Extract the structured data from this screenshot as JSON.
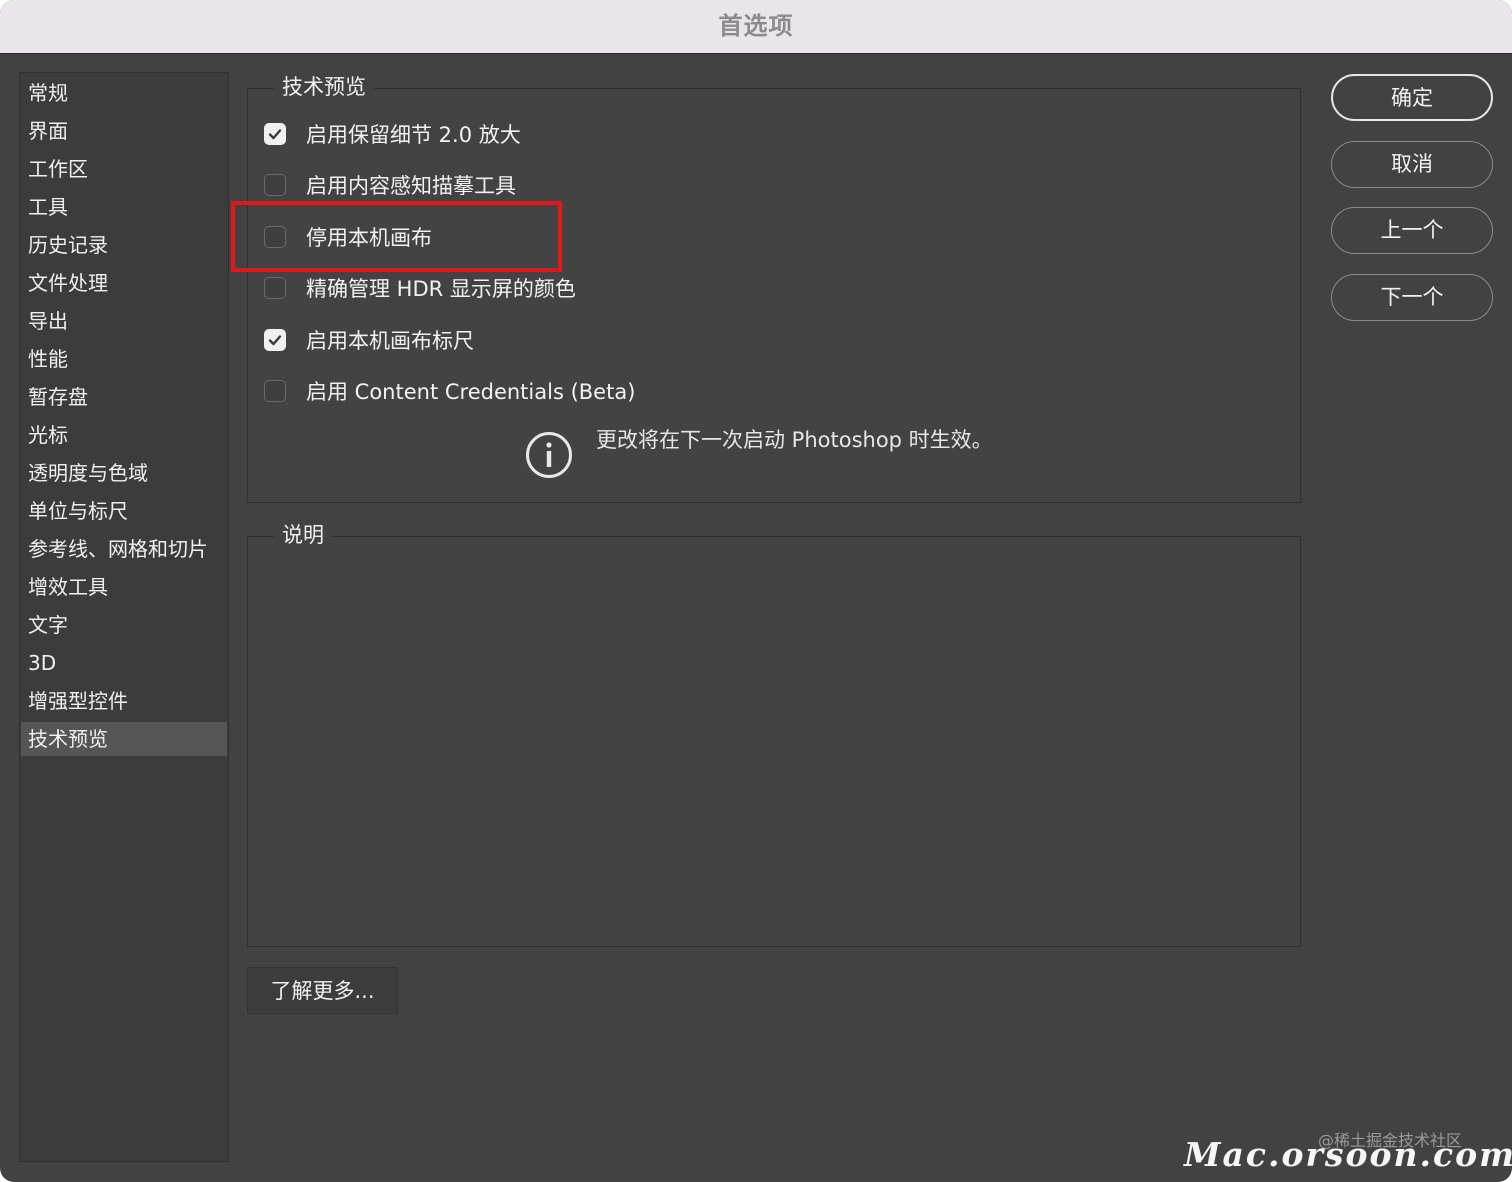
{
  "window": {
    "title": "首选项"
  },
  "sidebar": {
    "items": [
      {
        "label": "常规"
      },
      {
        "label": "界面"
      },
      {
        "label": "工作区"
      },
      {
        "label": "工具"
      },
      {
        "label": "历史记录"
      },
      {
        "label": "文件处理"
      },
      {
        "label": "导出"
      },
      {
        "label": "性能"
      },
      {
        "label": "暂存盘"
      },
      {
        "label": "光标"
      },
      {
        "label": "透明度与色域"
      },
      {
        "label": "单位与标尺"
      },
      {
        "label": "参考线、网格和切片"
      },
      {
        "label": "增效工具"
      },
      {
        "label": "文字"
      },
      {
        "label": "3D"
      },
      {
        "label": "增强型控件"
      },
      {
        "label": "技术预览"
      }
    ],
    "selected": "技术预览"
  },
  "tech_preview": {
    "title": "技术预览",
    "options": [
      {
        "label": "启用保留细节 2.0 放大",
        "checked": true
      },
      {
        "label": "启用内容感知描摹工具",
        "checked": false
      },
      {
        "label": "停用本机画布",
        "checked": false
      },
      {
        "label": "精确管理 HDR 显示屏的颜色",
        "checked": false
      },
      {
        "label": "启用本机画布标尺",
        "checked": true
      },
      {
        "label": "启用 Content Credentials (Beta)",
        "checked": false
      }
    ],
    "notice": "更改将在下一次启动 Photoshop 时生效。"
  },
  "description": {
    "title": "说明",
    "text": ""
  },
  "buttons": {
    "ok": "确定",
    "cancel": "取消",
    "prev": "上一个",
    "next": "下一个",
    "learn_more": "了解更多..."
  },
  "watermarks": {
    "community": "@稀土掘金技术社区",
    "site": "Mac.orsoon.com"
  },
  "colors": {
    "panel": "#424242",
    "highlight": "#e1191c",
    "text": "#f2f2f2"
  }
}
